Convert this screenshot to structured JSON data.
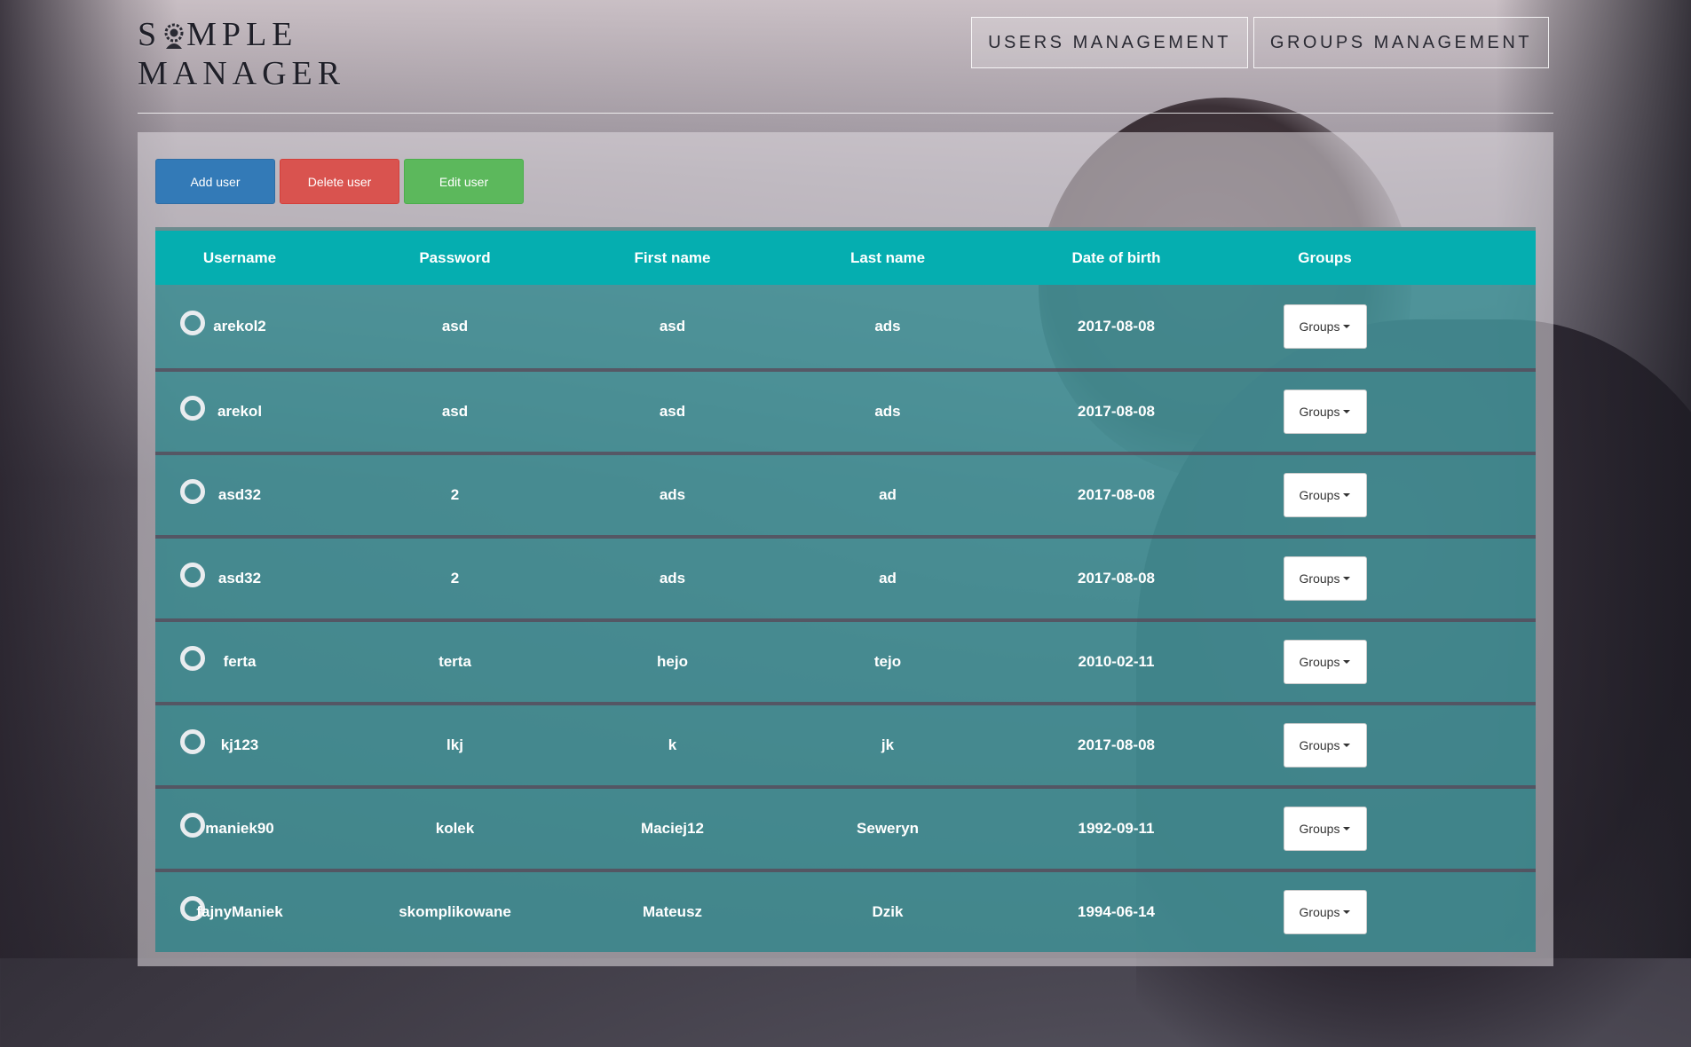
{
  "app": {
    "logo_line1_part1": "S",
    "logo_line1_part2": "MPLE",
    "logo_line2": "MANAGER"
  },
  "nav": {
    "users": "USERS MANAGEMENT",
    "groups": "GROUPS MANAGEMENT"
  },
  "toolbar": {
    "add_label": "Add user",
    "delete_label": "Delete user",
    "edit_label": "Edit user"
  },
  "colors": {
    "header_teal": "#05aeb0",
    "add_blue": "#337ab7",
    "delete_red": "#d9534f",
    "edit_green": "#5cb85c"
  },
  "table": {
    "columns": [
      "Username",
      "Password",
      "First name",
      "Last name",
      "Date of birth",
      "Groups"
    ],
    "groups_button_label": "Groups",
    "rows": [
      {
        "username": "arekol2",
        "password": "asd",
        "first_name": "asd",
        "last_name": "ads",
        "dob": "2017-08-08"
      },
      {
        "username": "arekol",
        "password": "asd",
        "first_name": "asd",
        "last_name": "ads",
        "dob": "2017-08-08"
      },
      {
        "username": "asd32",
        "password": "2",
        "first_name": "ads",
        "last_name": "ad",
        "dob": "2017-08-08"
      },
      {
        "username": "asd32",
        "password": "2",
        "first_name": "ads",
        "last_name": "ad",
        "dob": "2017-08-08"
      },
      {
        "username": "ferta",
        "password": "terta",
        "first_name": "hejo",
        "last_name": "tejo",
        "dob": "2010-02-11"
      },
      {
        "username": "kj123",
        "password": "lkj",
        "first_name": "k",
        "last_name": "jk",
        "dob": "2017-08-08"
      },
      {
        "username": "maniek90",
        "password": "kolek",
        "first_name": "Maciej12",
        "last_name": "Seweryn",
        "dob": "1992-09-11"
      },
      {
        "username": "fajnyManiek",
        "password": "skomplikowane",
        "first_name": "Mateusz",
        "last_name": "Dzik",
        "dob": "1994-06-14"
      }
    ]
  }
}
